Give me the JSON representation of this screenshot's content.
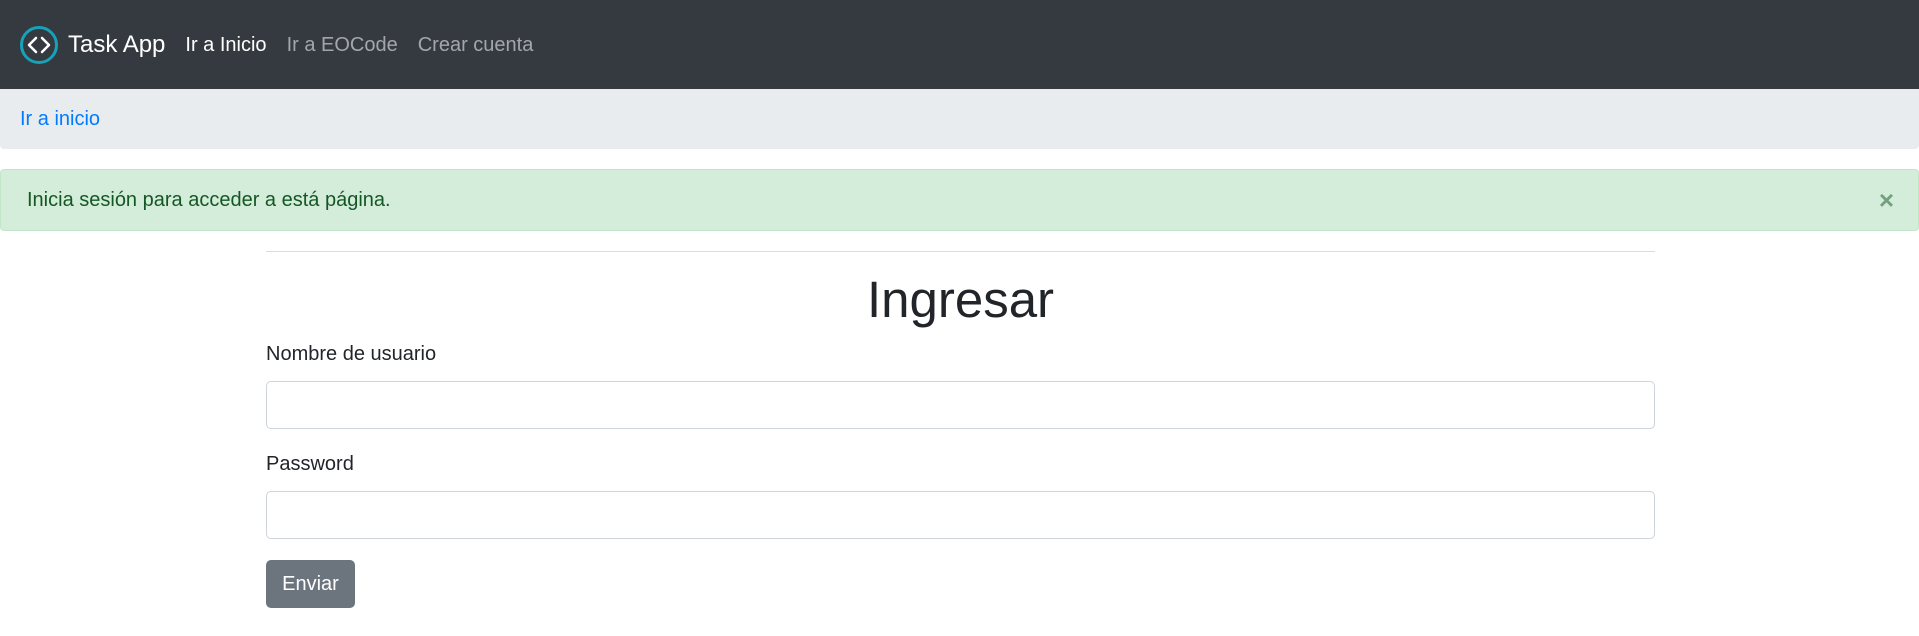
{
  "navbar": {
    "brand_text": "Task App",
    "logo_icon": "code-brackets-circle-icon",
    "links": [
      {
        "label": "Ir a Inicio",
        "active": true
      },
      {
        "label": "Ir a EOCode",
        "active": false
      },
      {
        "label": "Crear cuenta",
        "active": false
      }
    ]
  },
  "breadcrumb": {
    "link_label": "Ir a inicio"
  },
  "alert": {
    "message": "Inicia sesión para acceder a está página.",
    "close_symbol": "×"
  },
  "form": {
    "title": "Ingresar",
    "username_label": "Nombre de usuario",
    "username_value": "",
    "password_label": "Password",
    "password_value": "",
    "submit_label": "Enviar"
  },
  "colors": {
    "navbar_bg": "#343a40",
    "breadcrumb_bg": "#e9ecef",
    "link": "#007bff",
    "alert_bg": "#d4edda",
    "alert_text": "#155724",
    "logo_accent": "#17a2b8",
    "button_bg": "#6c757d"
  }
}
